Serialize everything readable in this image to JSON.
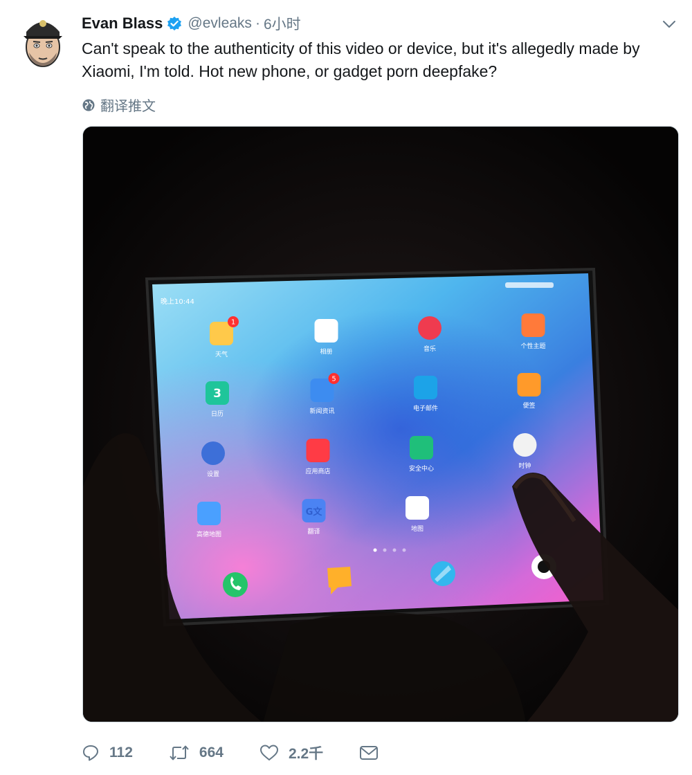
{
  "tweet": {
    "author_name": "Evan Blass",
    "handle": "@evleaks",
    "separator": "·",
    "time": "6小时",
    "text": "Can't speak to the authenticity of this video or device, but it's allegedly made by Xiaomi, I'm told. Hot new phone, or gadget porn deepfake?",
    "translate_label": "翻译推文",
    "verified_color": "#1da1f2"
  },
  "media": {
    "status_time": "晚上10:44",
    "apps": [
      {
        "label": "天气",
        "badge": "1"
      },
      {
        "label": "相册"
      },
      {
        "label": "音乐"
      },
      {
        "label": "个性主题"
      },
      {
        "label": "日历",
        "icon_text": "3"
      },
      {
        "label": "新闻资讯",
        "badge": "5"
      },
      {
        "label": "电子邮件"
      },
      {
        "label": "便签"
      },
      {
        "label": "设置"
      },
      {
        "label": "应用商店"
      },
      {
        "label": "安全中心"
      },
      {
        "label": "时钟"
      },
      {
        "label": "高德地图"
      },
      {
        "label": "翻译",
        "icon_text": "G文"
      },
      {
        "label": "地图"
      }
    ]
  },
  "actions": {
    "reply_count": "112",
    "retweet_count": "664",
    "like_count": "2.2千"
  },
  "colors": {
    "text_primary": "#14171a",
    "text_secondary": "#657786"
  }
}
